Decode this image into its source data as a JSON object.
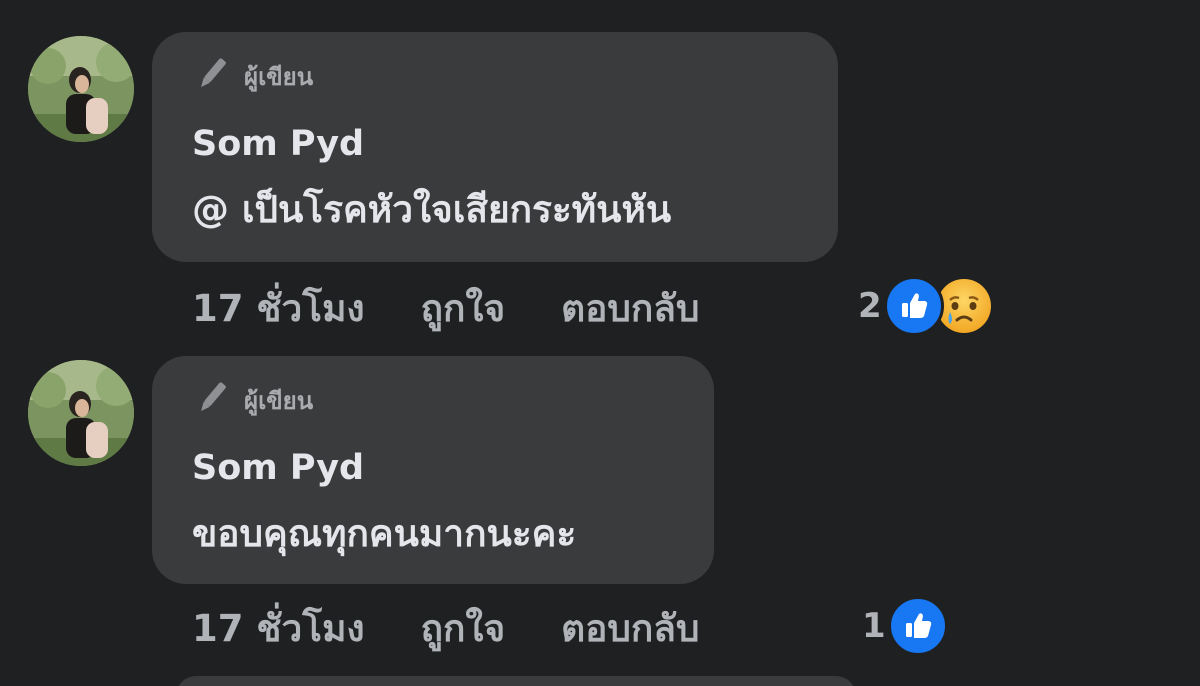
{
  "colors": {
    "background": "#1f2021",
    "bubble": "#3a3b3c",
    "primary_text": "#e4e6eb",
    "secondary_text": "#b0b3b8",
    "like_blue": "#1877f2",
    "sad_yellow": "#f7b125"
  },
  "comments": [
    {
      "badge_icon": "pen-icon",
      "badge_label": "ผู้เขียน",
      "author": "Som Pyd",
      "text": "@ เป็นโรคหัวใจเสียกระทันหัน",
      "time": "17 ชั่วโมง",
      "like_label": "ถูกใจ",
      "reply_label": "ตอบกลับ",
      "reaction_count": "2",
      "reaction_icons": [
        "like-icon",
        "sad-icon"
      ]
    },
    {
      "badge_icon": "pen-icon",
      "badge_label": "ผู้เขียน",
      "author": "Som Pyd",
      "text": "ขอบคุณทุกคนมากนะคะ",
      "time": "17 ชั่วโมง",
      "like_label": "ถูกใจ",
      "reply_label": "ตอบกลับ",
      "reaction_count": "1",
      "reaction_icons": [
        "like-icon"
      ]
    }
  ]
}
